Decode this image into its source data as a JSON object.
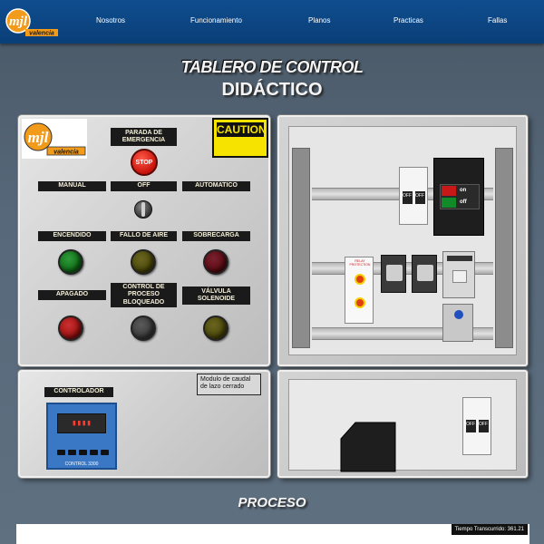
{
  "brand": {
    "logo_mark": "mjl",
    "logo_text": "valencia"
  },
  "nav": {
    "items": [
      "Nosotros",
      "Funcionamiento",
      "Planos",
      "Practicas",
      "Fallas"
    ]
  },
  "hero": {
    "title_line1": "TABLERO DE CONTROL",
    "title_line2": "DIDÁCTICO"
  },
  "control_panel": {
    "emergency_label": "PARADA DE EMERGENCIA",
    "stop_label": "STOP",
    "caution_label": "CAUTION",
    "selector": {
      "manual": "MANUAL",
      "off": "OFF",
      "auto": "AUTOMATICO"
    },
    "lamps": [
      {
        "label": "ENCENDIDO",
        "color": "#0d6a14"
      },
      {
        "label": "FALLO DE AIRE",
        "color": "#4a4608"
      },
      {
        "label": "SOBRECARGA",
        "color": "#5a0a10"
      },
      {
        "label": "APAGADO",
        "color": "#9a1010"
      },
      {
        "label": "CONTROL DE PROCESO BLOQUEADO",
        "color": "#3a3a3a"
      },
      {
        "label": "VÁLVULA SOLENOIDE",
        "color": "#4a4608"
      }
    ]
  },
  "controller_panel": {
    "label": "CONTROLADOR",
    "device_label": "CONTROL 3300",
    "note": "Modulo de caudal de lazo cerrado"
  },
  "cabinet": {
    "breaker_labels": [
      "OFF",
      "OFF"
    ],
    "main_breaker_labels": [
      "on",
      "off"
    ],
    "relay_label": "RELAY PROTECTION",
    "lower_breaker_labels": [
      "OFF",
      "OFF"
    ]
  },
  "process": {
    "title": "PROCESO",
    "timer_label": "Tiempo Transcurrido: 361.21"
  },
  "colors": {
    "header": "#0f4d8f",
    "accent_yellow": "#f6e400",
    "stop_red": "#c8120a"
  }
}
